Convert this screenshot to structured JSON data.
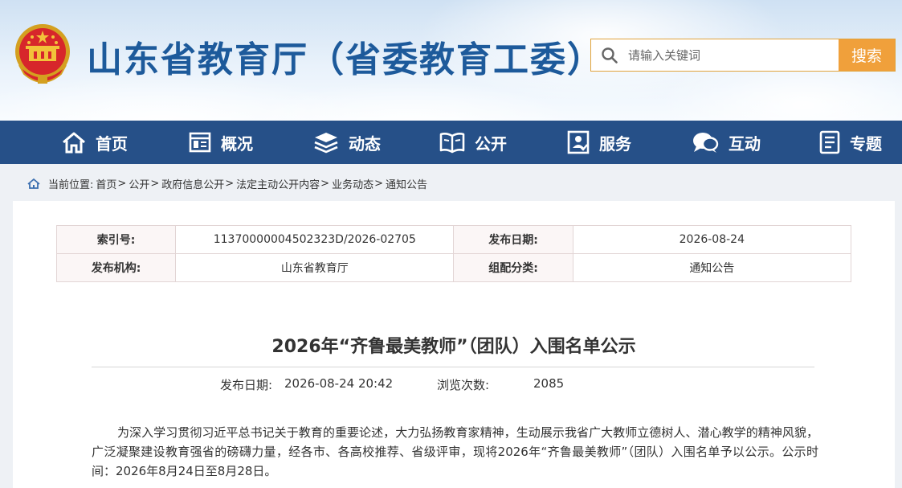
{
  "header": {
    "site_title": "山东省教育厅（省委教育工委）",
    "emblem": "national-emblem-icon",
    "search": {
      "placeholder": "请输入关键词",
      "button_label": "搜索"
    }
  },
  "nav": [
    {
      "label": "首页",
      "icon": "home-icon"
    },
    {
      "label": "概况",
      "icon": "overview-icon"
    },
    {
      "label": "动态",
      "icon": "stack-icon"
    },
    {
      "label": "公开",
      "icon": "book-icon"
    },
    {
      "label": "服务",
      "icon": "service-icon"
    },
    {
      "label": "互动",
      "icon": "chat-icon"
    },
    {
      "label": "专题",
      "icon": "document-icon"
    }
  ],
  "breadcrumb": {
    "prefix": "当前位置:",
    "items": [
      "首页",
      "公开",
      "政府信息公开",
      "法定主动公开内容",
      "业务动态",
      "通知公告"
    ]
  },
  "meta": {
    "index_label": "索引号:",
    "index_value": "11370000004502323D/2026-02705",
    "date_label": "发布日期:",
    "date_value": "2026-08-24",
    "org_label": "发布机构:",
    "org_value": "山东省教育厅",
    "category_label": "组配分类:",
    "category_value": "通知公告"
  },
  "article": {
    "title": "2026年“齐鲁最美教师”（团队）入围名单公示",
    "pub_date_label": "发布日期:",
    "pub_date_value": "2026-08-24 20:42",
    "views_label": "浏览次数:",
    "views_value": "2085",
    "body": "为深入学习贯彻习近平总书记关于教育的重要论述，大力弘扬教育家精神，生动展示我省广大教师立德树人、潜心教学的精神风貌，广泛凝聚建设教育强省的磅礴力量，经各市、各高校推荐、省级评审，现将2026年“齐鲁最美教师”（团队）入围名单予以公示。公示时间：2026年8月24日至8月28日。"
  },
  "colors": {
    "nav_bg": "#265088",
    "title_blue": "#1d5a9b",
    "search_orange": "#f0a03b"
  }
}
